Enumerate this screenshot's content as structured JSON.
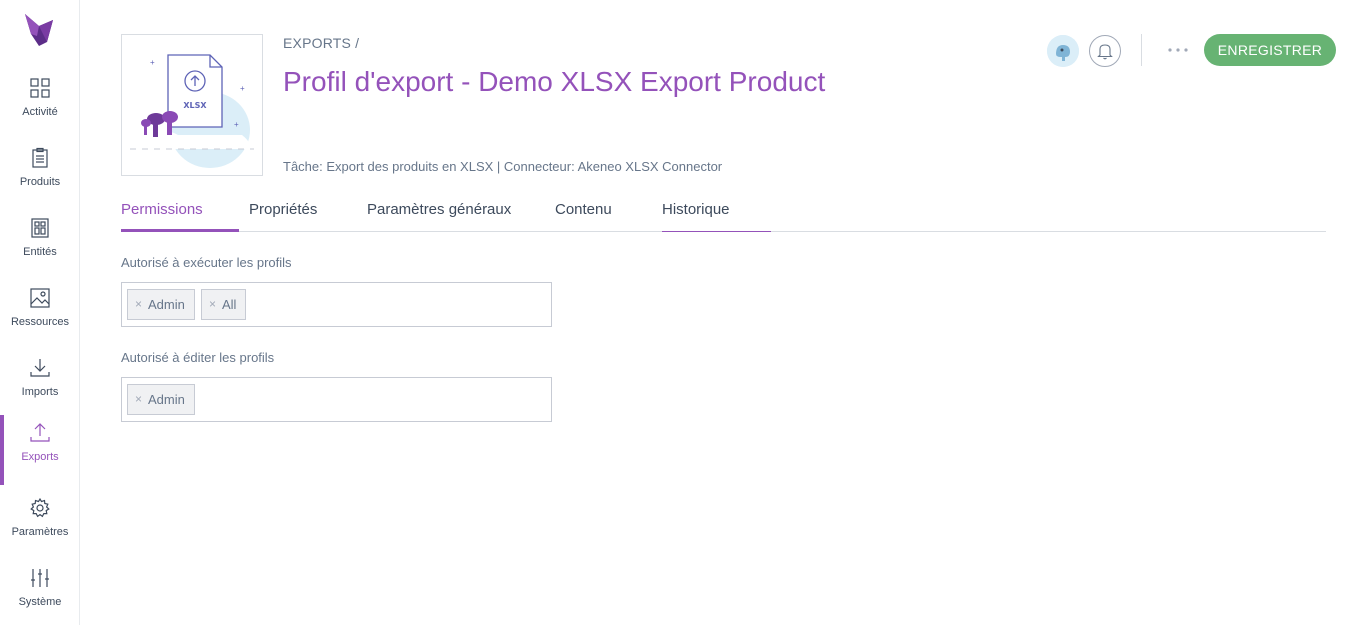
{
  "sidebar": {
    "items": [
      {
        "label": "Activité",
        "icon": "dashboard-icon"
      },
      {
        "label": "Produits",
        "icon": "clipboard-icon"
      },
      {
        "label": "Entités",
        "icon": "entities-icon"
      },
      {
        "label": "Ressources",
        "icon": "image-icon"
      },
      {
        "label": "Imports",
        "icon": "import-icon"
      },
      {
        "label": "Exports",
        "icon": "export-icon",
        "active": true
      },
      {
        "label": "Paramètres",
        "icon": "gear-icon"
      },
      {
        "label": "Système",
        "icon": "sliders-icon"
      }
    ]
  },
  "header": {
    "breadcrumb": "EXPORTS /",
    "title": "Profil d'export - Demo XLSX Export Product",
    "meta": "Tâche: Export des produits en XLSX | Connecteur: Akeneo XLSX Connector",
    "thumbnail_label": "XLSX",
    "save_label": "ENREGISTRER"
  },
  "tabs": [
    {
      "label": "Permissions",
      "active": true
    },
    {
      "label": "Propriétés"
    },
    {
      "label": "Paramètres généraux"
    },
    {
      "label": "Contenu"
    },
    {
      "label": "Historique"
    }
  ],
  "fields": {
    "execute": {
      "label": "Autorisé à exécuter les profils",
      "tags": [
        "Admin",
        "All"
      ]
    },
    "edit": {
      "label": "Autorisé à éditer les profils",
      "tags": [
        "Admin"
      ]
    }
  },
  "colors": {
    "accent": "#9452ba",
    "save": "#67b373",
    "text": "#67768a"
  }
}
